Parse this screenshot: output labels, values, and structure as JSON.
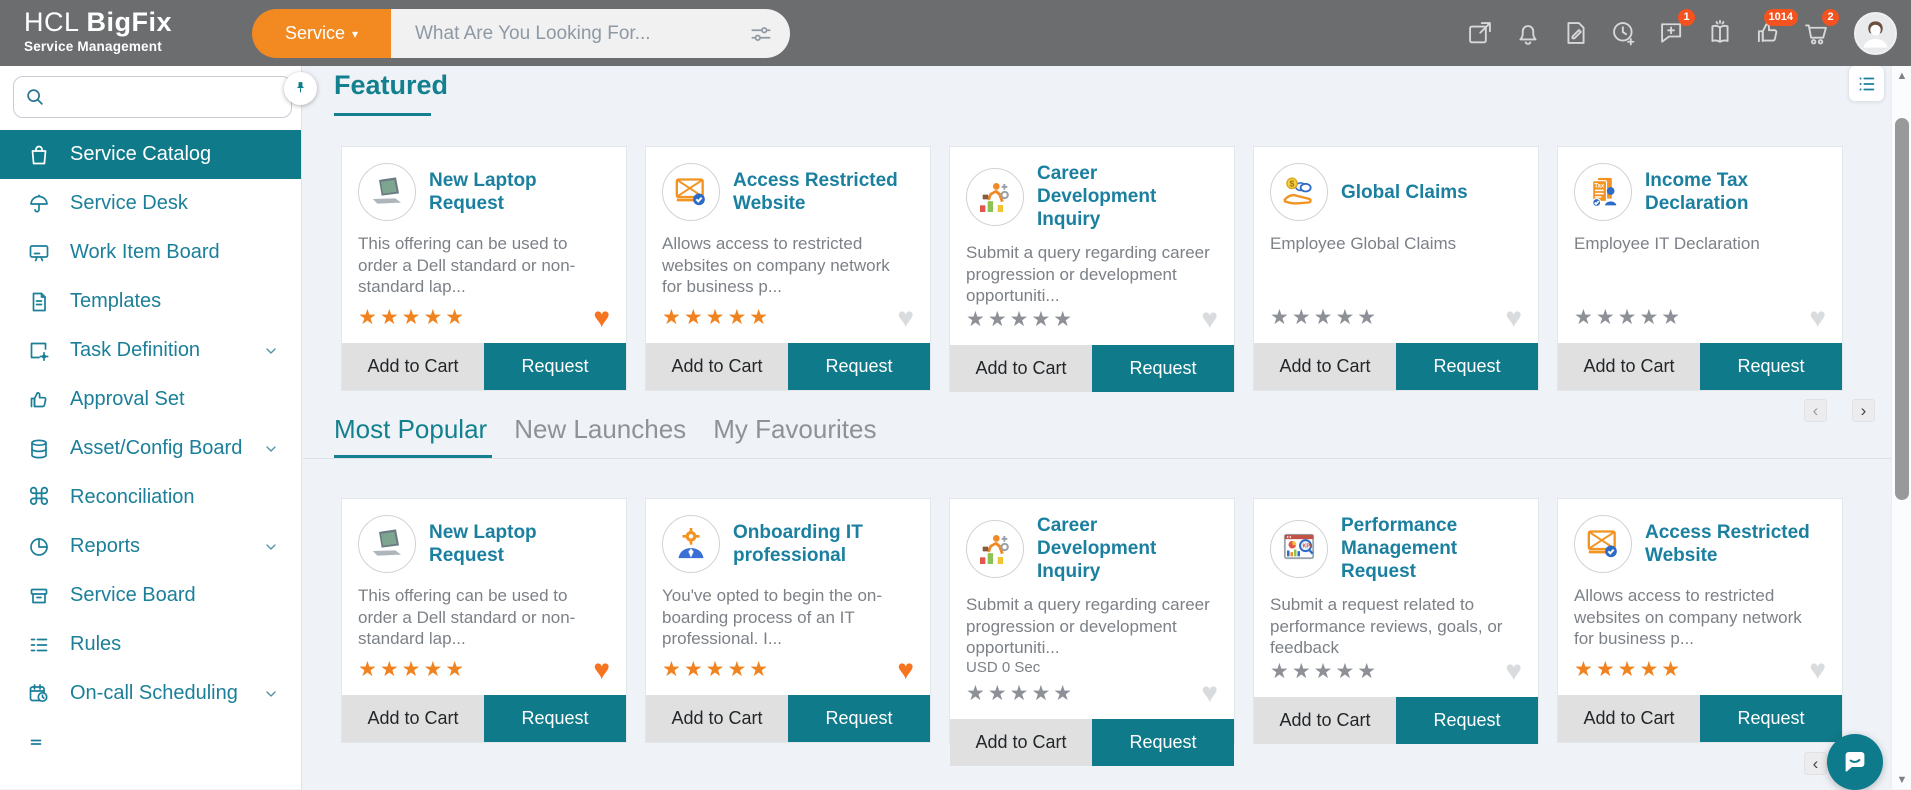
{
  "topbar": {
    "logo": {
      "line1_regular": "HCL ",
      "line1_bold": "BigFix",
      "line2": "Service Management"
    },
    "service_menu": {
      "label": "Service",
      "caret": "▾"
    },
    "search": {
      "placeholder": "What Are You Looking For..."
    },
    "badges": {
      "chat": "1",
      "likes": "1014",
      "cart": "2"
    },
    "icons": [
      "external-link-icon",
      "bell-icon",
      "document-edit-icon",
      "clock-add-icon",
      "chat-add-icon",
      "knowledge-book-icon",
      "thumbs-up-icon",
      "cart-icon",
      "avatar"
    ]
  },
  "sidebar": {
    "items": [
      {
        "label": "Service Catalog",
        "icon": "shopping-bag-icon",
        "active": true
      },
      {
        "label": "Service Desk",
        "icon": "umbrella-icon"
      },
      {
        "label": "Work Item Board",
        "icon": "board-icon"
      },
      {
        "label": "Templates",
        "icon": "document-icon"
      },
      {
        "label": "Task Definition",
        "icon": "task-gear-icon",
        "expandable": true
      },
      {
        "label": "Approval Set",
        "icon": "thumbs-up-page-icon"
      },
      {
        "label": "Asset/Config Board",
        "icon": "database-icon",
        "expandable": true
      },
      {
        "label": "Reconciliation",
        "icon": "command-icon"
      },
      {
        "label": "Reports",
        "icon": "pie-chart-icon",
        "expandable": true
      },
      {
        "label": "Service Board",
        "icon": "archive-box-icon"
      },
      {
        "label": "Rules",
        "icon": "checklist-icon"
      },
      {
        "label": "On-call Scheduling",
        "icon": "calendar-clock-icon",
        "expandable": true
      },
      {
        "label": "",
        "icon": "more-lines-icon"
      }
    ]
  },
  "featured": {
    "title": "Featured",
    "cards": [
      {
        "title": "New Laptop Request",
        "icon": "laptop-icon",
        "description": "This offering can be used to order a Dell standard or non-standard lap...",
        "stars": "★★★★★",
        "rated": true,
        "favourite": true
      },
      {
        "title": "Access Restricted Website",
        "icon": "blocked-website-icon",
        "description": "Allows access to restricted websites on company network for business p...",
        "stars": "★★★★★",
        "rated": true,
        "favourite": false
      },
      {
        "title": "Career Development Inquiry",
        "icon": "career-development-icon",
        "description": "Submit a query regarding career progression or development opportuniti...",
        "stars": "★★★★★",
        "rated": false,
        "favourite": false
      },
      {
        "title": "Global Claims",
        "icon": "claims-hand-coins-icon",
        "description": "Employee Global Claims",
        "stars": "★★★★★",
        "rated": false,
        "favourite": false
      },
      {
        "title": "Income Tax Declaration",
        "icon": "tax-document-icon",
        "description": "Employee IT Declaration",
        "stars": "★★★★★",
        "rated": false,
        "favourite": false
      }
    ]
  },
  "tabs": [
    {
      "label": "Most Popular",
      "active": true
    },
    {
      "label": "New Launches",
      "active": false
    },
    {
      "label": "My Favourites",
      "active": false
    }
  ],
  "popular": {
    "cards": [
      {
        "title": "New Laptop Request",
        "icon": "laptop-icon",
        "description": "This offering can be used to order a Dell standard or non-standard lap...",
        "stars": "★★★★★",
        "rated": true,
        "favourite": true
      },
      {
        "title": "Onboarding IT professional",
        "icon": "onboarding-gear-person-icon",
        "description": "You've opted to begin the on-boarding process of an IT professional. I...",
        "stars": "★★★★★",
        "rated": true,
        "favourite": true
      },
      {
        "title": "Career Development Inquiry",
        "icon": "career-development-icon",
        "description": "Submit a query regarding career progression or development opportuniti...",
        "price": "USD 0 Sec",
        "stars": "★★★★★",
        "rated": false,
        "favourite": false
      },
      {
        "title": "Performance Management Request",
        "icon": "performance-dashboard-icon",
        "description": "Submit a request related to performance reviews, goals, or feedback",
        "stars": "★★★★★",
        "rated": false,
        "favourite": false
      },
      {
        "title": "Access Restricted Website",
        "icon": "blocked-website-icon",
        "description": "Allows access to restricted websites on company network for business p...",
        "stars": "★★★★★",
        "rated": true,
        "favourite": false
      }
    ]
  },
  "labels": {
    "add_to_cart": "Add to Cart",
    "request": "Request",
    "heart": "♥",
    "prev": "‹",
    "next": "›",
    "scroll_up": "▲",
    "scroll_down": "▼"
  },
  "colors": {
    "header_bg": "#6c6d6f",
    "accent_orange": "#f28a21",
    "badge_red": "#f4521f",
    "brand_teal": "#0f7a89",
    "link_teal": "#1b80a0",
    "content_bg": "#eff3f8",
    "star_orange": "#f0831f",
    "star_gray": "#8d9096"
  }
}
